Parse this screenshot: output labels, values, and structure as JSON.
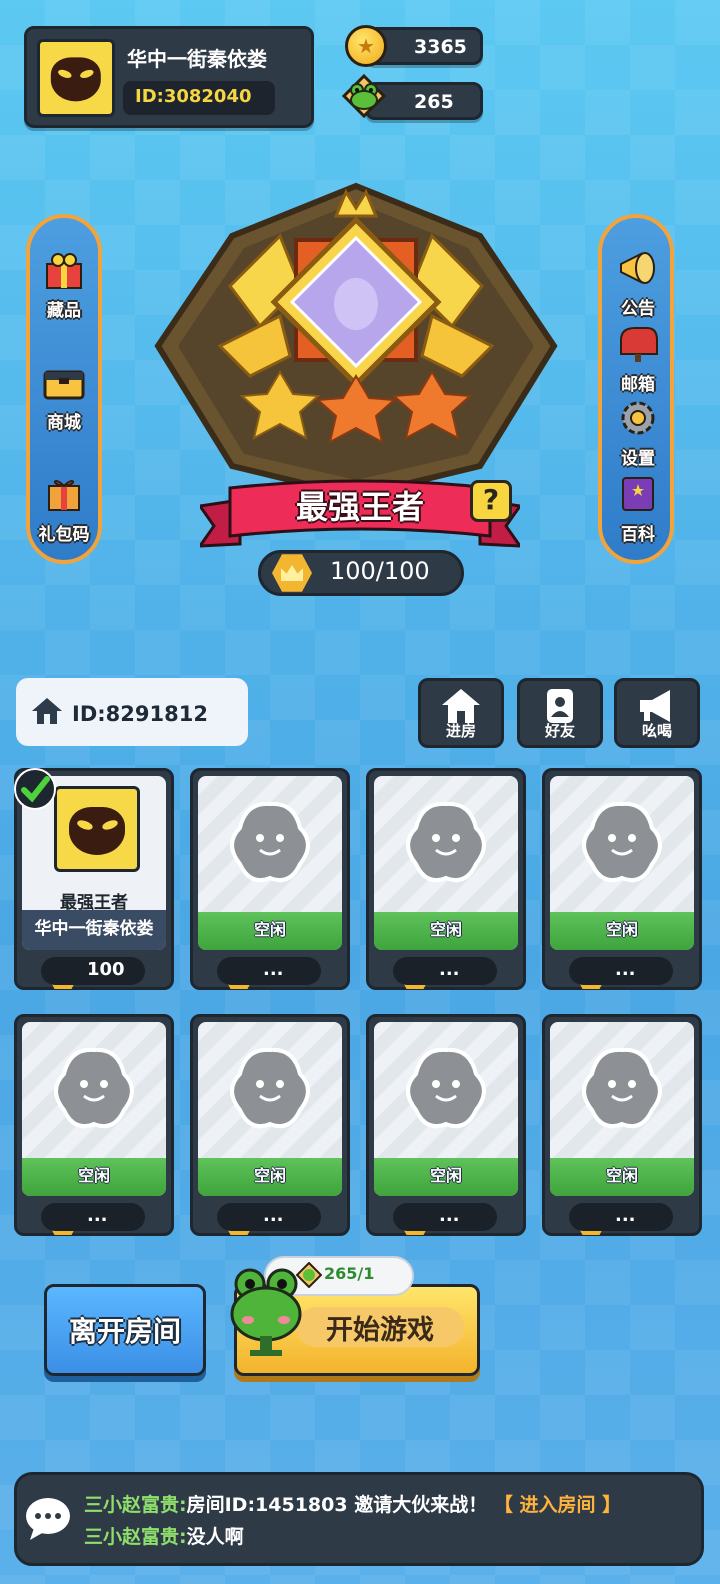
{
  "profile": {
    "name": "华中一街秦依娄",
    "id": "ID:3082040"
  },
  "currency": {
    "coins": "3365",
    "leaves": "265"
  },
  "left_menu": [
    {
      "label": "藏品",
      "icon": "gift-box-icon"
    },
    {
      "label": "商城",
      "icon": "briefcase-icon"
    },
    {
      "label": "礼包码",
      "icon": "gift-pack-icon"
    }
  ],
  "right_menu": [
    {
      "label": "公告",
      "icon": "megaphone-icon"
    },
    {
      "label": "邮箱",
      "icon": "mailbox-icon"
    },
    {
      "label": "设置",
      "icon": "gear-icon"
    },
    {
      "label": "百科",
      "icon": "book-icon"
    }
  ],
  "rank": {
    "title": "最强王者",
    "help": "?",
    "score": "100/100"
  },
  "room": {
    "id": "ID:8291812",
    "buttons": {
      "enter": "进房",
      "friends": "好友",
      "shout": "吆喝"
    }
  },
  "slots": [
    {
      "type": "player",
      "rank": "最强王者",
      "name": "华中一街秦依娄",
      "score": "100"
    },
    {
      "type": "empty",
      "status": "空闲",
      "score": "..."
    },
    {
      "type": "empty",
      "status": "空闲",
      "score": "..."
    },
    {
      "type": "empty",
      "status": "空闲",
      "score": "..."
    },
    {
      "type": "empty",
      "status": "空闲",
      "score": "..."
    },
    {
      "type": "empty",
      "status": "空闲",
      "score": "..."
    },
    {
      "type": "empty",
      "status": "空闲",
      "score": "..."
    },
    {
      "type": "empty",
      "status": "空闲",
      "score": "..."
    }
  ],
  "actions": {
    "leave": "离开房间",
    "start": "开始游戏",
    "cost": "265/1"
  },
  "chat": [
    {
      "user": "三小赵富贵:",
      "text": "房间ID:1451803 邀请大伙来战！",
      "link": "【 进入房间 】"
    },
    {
      "user": "三小赵富贵:",
      "text": "没人啊",
      "link": ""
    }
  ],
  "colors": {
    "accent": "#f5d642",
    "panel": "#2f3a47",
    "green": "#5fc25a"
  }
}
